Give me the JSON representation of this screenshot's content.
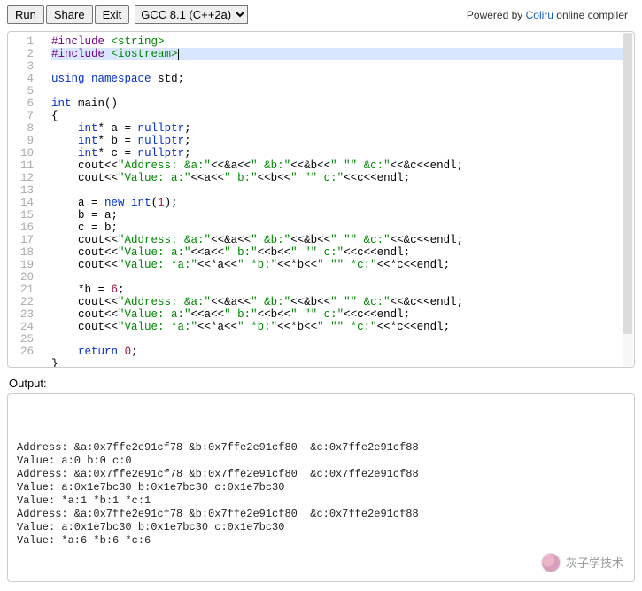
{
  "toolbar": {
    "run": "Run",
    "share": "Share",
    "exit": "Exit",
    "compiler": "GCC 8.1 (C++2a)"
  },
  "powered": {
    "prefix": "Powered by ",
    "link": "Coliru",
    "suffix": " online compiler"
  },
  "gutter_start": 1,
  "gutter_end": 26,
  "highlighted_line": 2,
  "code_lines": [
    [
      [
        "pp",
        "#include"
      ],
      [
        "",
        " "
      ],
      [
        "inc",
        "<string>"
      ]
    ],
    [
      [
        "pp",
        "#include"
      ],
      [
        "",
        " "
      ],
      [
        "inc",
        "<iostream>"
      ]
    ],
    [
      [
        "kw",
        "using"
      ],
      [
        "",
        " "
      ],
      [
        "kw",
        "namespace"
      ],
      [
        "",
        " std;"
      ]
    ],
    [
      [
        "",
        ""
      ]
    ],
    [
      [
        "kw",
        "int"
      ],
      [
        "",
        " main()"
      ]
    ],
    [
      [
        "",
        "{"
      ]
    ],
    [
      [
        "",
        "    "
      ],
      [
        "kw",
        "int"
      ],
      [
        "",
        "* a = "
      ],
      [
        "kw",
        "nullptr"
      ],
      [
        "",
        ";"
      ]
    ],
    [
      [
        "",
        "    "
      ],
      [
        "kw",
        "int"
      ],
      [
        "",
        "* b = "
      ],
      [
        "kw",
        "nullptr"
      ],
      [
        "",
        ";"
      ]
    ],
    [
      [
        "",
        "    "
      ],
      [
        "kw",
        "int"
      ],
      [
        "",
        "* c = "
      ],
      [
        "kw",
        "nullptr"
      ],
      [
        "",
        ";"
      ]
    ],
    [
      [
        "",
        "    cout<<"
      ],
      [
        "str",
        "\"Address: &a:\""
      ],
      [
        "",
        "<<&a<<"
      ],
      [
        "str",
        "\" &b:\""
      ],
      [
        "",
        "<<&b<<"
      ],
      [
        "str",
        "\" \""
      ],
      [
        "",
        ""
      ],
      [
        "str",
        "\" &c:\""
      ],
      [
        "",
        "<<&c<<endl;"
      ]
    ],
    [
      [
        "",
        "    cout<<"
      ],
      [
        "str",
        "\"Value: a:\""
      ],
      [
        "",
        "<<a<<"
      ],
      [
        "str",
        "\" b:\""
      ],
      [
        "",
        "<<b<<"
      ],
      [
        "str",
        "\" \""
      ],
      [
        "",
        ""
      ],
      [
        "str",
        "\" c:\""
      ],
      [
        "",
        "<<c<<endl;"
      ]
    ],
    [
      [
        "",
        ""
      ]
    ],
    [
      [
        "",
        "    a = "
      ],
      [
        "kw",
        "new"
      ],
      [
        "",
        " "
      ],
      [
        "kw",
        "int"
      ],
      [
        "",
        "("
      ],
      [
        "num",
        "1"
      ],
      [
        "",
        ");"
      ]
    ],
    [
      [
        "",
        "    b = a;"
      ]
    ],
    [
      [
        "",
        "    c = b;"
      ]
    ],
    [
      [
        "",
        "    cout<<"
      ],
      [
        "str",
        "\"Address: &a:\""
      ],
      [
        "",
        "<<&a<<"
      ],
      [
        "str",
        "\" &b:\""
      ],
      [
        "",
        "<<&b<<"
      ],
      [
        "str",
        "\" \""
      ],
      [
        "",
        ""
      ],
      [
        "str",
        "\" &c:\""
      ],
      [
        "",
        "<<&c<<endl;"
      ]
    ],
    [
      [
        "",
        "    cout<<"
      ],
      [
        "str",
        "\"Value: a:\""
      ],
      [
        "",
        "<<a<<"
      ],
      [
        "str",
        "\" b:\""
      ],
      [
        "",
        "<<b<<"
      ],
      [
        "str",
        "\" \""
      ],
      [
        "",
        ""
      ],
      [
        "str",
        "\" c:\""
      ],
      [
        "",
        "<<c<<endl;"
      ]
    ],
    [
      [
        "",
        "    cout<<"
      ],
      [
        "str",
        "\"Value: *a:\""
      ],
      [
        "",
        "<<*a<<"
      ],
      [
        "str",
        "\" *b:\""
      ],
      [
        "",
        "<<*b<<"
      ],
      [
        "str",
        "\" \""
      ],
      [
        "",
        ""
      ],
      [
        "str",
        "\" *c:\""
      ],
      [
        "",
        "<<*c<<endl;"
      ]
    ],
    [
      [
        "",
        ""
      ]
    ],
    [
      [
        "",
        "    *b = "
      ],
      [
        "num",
        "6"
      ],
      [
        "",
        ";"
      ]
    ],
    [
      [
        "",
        "    cout<<"
      ],
      [
        "str",
        "\"Address: &a:\""
      ],
      [
        "",
        "<<&a<<"
      ],
      [
        "str",
        "\" &b:\""
      ],
      [
        "",
        "<<&b<<"
      ],
      [
        "str",
        "\" \""
      ],
      [
        "",
        ""
      ],
      [
        "str",
        "\" &c:\""
      ],
      [
        "",
        "<<&c<<endl;"
      ]
    ],
    [
      [
        "",
        "    cout<<"
      ],
      [
        "str",
        "\"Value: a:\""
      ],
      [
        "",
        "<<a<<"
      ],
      [
        "str",
        "\" b:\""
      ],
      [
        "",
        "<<b<<"
      ],
      [
        "str",
        "\" \""
      ],
      [
        "",
        ""
      ],
      [
        "str",
        "\" c:\""
      ],
      [
        "",
        "<<c<<endl;"
      ]
    ],
    [
      [
        "",
        "    cout<<"
      ],
      [
        "str",
        "\"Value: *a:\""
      ],
      [
        "",
        "<<*a<<"
      ],
      [
        "str",
        "\" *b:\""
      ],
      [
        "",
        "<<*b<<"
      ],
      [
        "str",
        "\" \""
      ],
      [
        "",
        ""
      ],
      [
        "str",
        "\" *c:\""
      ],
      [
        "",
        "<<*c<<endl;"
      ]
    ],
    [
      [
        "",
        ""
      ]
    ],
    [
      [
        "",
        "    "
      ],
      [
        "kw",
        "return"
      ],
      [
        "",
        " "
      ],
      [
        "num",
        "0"
      ],
      [
        "",
        ";"
      ]
    ],
    [
      [
        "",
        "}"
      ]
    ]
  ],
  "output_label": "Output:",
  "output_lines": [
    "",
    "Address: &a:0x7ffe2e91cf78 &b:0x7ffe2e91cf80  &c:0x7ffe2e91cf88",
    "Value: a:0 b:0 c:0",
    "Address: &a:0x7ffe2e91cf78 &b:0x7ffe2e91cf80  &c:0x7ffe2e91cf88",
    "Value: a:0x1e7bc30 b:0x1e7bc30 c:0x1e7bc30",
    "Value: *a:1 *b:1 *c:1",
    "Address: &a:0x7ffe2e91cf78 &b:0x7ffe2e91cf80  &c:0x7ffe2e91cf88",
    "Value: a:0x1e7bc30 b:0x1e7bc30 c:0x1e7bc30",
    "Value: *a:6 *b:6 *c:6"
  ],
  "watermark": "灰子学技术"
}
